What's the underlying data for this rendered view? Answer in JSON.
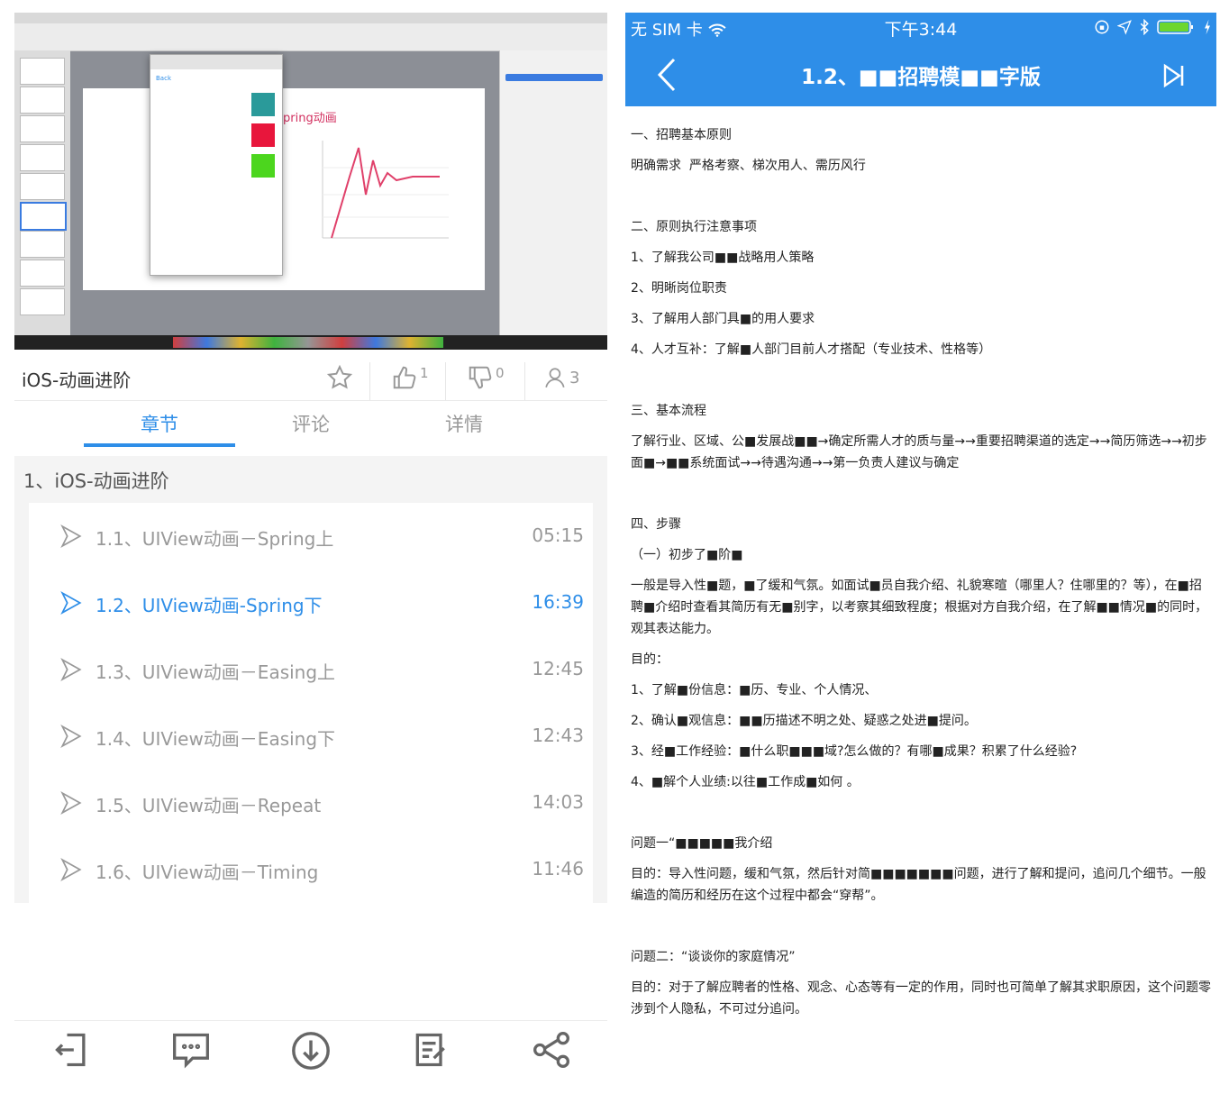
{
  "course": {
    "title": "iOS-动画进阶",
    "likes": "1",
    "dislikes": "0",
    "students": "3"
  },
  "video_preview": {
    "slide_title": "pring动画",
    "back_label": "Back"
  },
  "tabs": [
    {
      "label": "章节",
      "active": true
    },
    {
      "label": "评论",
      "active": false
    },
    {
      "label": "详情",
      "active": false
    }
  ],
  "section": {
    "title": "1、iOS-动画进阶"
  },
  "lessons": [
    {
      "label": "1.1、UIView动画－Spring上",
      "duration": "05:15",
      "active": false
    },
    {
      "label": "1.2、UIView动画-Spring下",
      "duration": "16:39",
      "active": true
    },
    {
      "label": "1.3、UIView动画－Easing上",
      "duration": "12:45",
      "active": false
    },
    {
      "label": "1.4、UIView动画－Easing下",
      "duration": "12:43",
      "active": false
    },
    {
      "label": "1.5、UIView动画－Repeat",
      "duration": "14:03",
      "active": false
    },
    {
      "label": "1.6、UIView动画－Timing",
      "duration": "11:46",
      "active": false
    }
  ],
  "bottom_toolbar": [
    "exit-icon",
    "message-icon",
    "download-icon",
    "note-icon",
    "share-icon"
  ],
  "phone": {
    "carrier": "无 SIM 卡",
    "time": "下午3:44",
    "nav_title": "1.2、■■招聘模■■字版"
  },
  "document": {
    "p1": "一、招聘基本原则",
    "p2": "明确需求  严格考察、梯次用人、需历风行",
    "p3": "二、原则执行注意事项",
    "p4": "1、了解我公司■■战略用人策略",
    "p5": "2、明晰岗位职责",
    "p6": "3、了解用人部门具■的用人要求",
    "p7": "4、人才互补：了解■人部门目前人才搭配（专业技术、性格等）",
    "p8": "三、基本流程",
    "p9": "了解行业、区域、公■发展战■■→确定所需人才的质与量→→重要招聘渠道的选定→→简历筛选→→初步面■→■■系统面试→→待遇沟通→→第一负责人建议与确定",
    "p10": "四、步骤",
    "p11": "（一）初步了■阶■",
    "p12": "一般是导入性■题，■了缓和气氛。如面试■员自我介绍、礼貌寒暄（哪里人？住哪里的？等），在■招聘■介绍时查看其简历有无■别字，以考察其细致程度；根据对方自我介绍，在了解■■情况■的同时，观其表达能力。",
    "p13": "目的：",
    "p14": "1、了解■份信息：■历、专业、个人情况、",
    "p15": "2、确认■观信息：■■历描述不明之处、疑惑之处进■提问。",
    "p16": "3、经■工作经验：■什么职■■■域?怎么做的？有哪■成果？积累了什么经验?",
    "p17": "4、■解个人业绩:以往■工作成■如何 。",
    "p18": "问题一“■■■■■我介绍",
    "p19": "目的：导入性问题，缓和气氛，然后针对简■■■■■■■问题，进行了解和提问，追问几个细节。一般编造的简历和经历在这个过程中都会“穿帮”。",
    "p20": "问题二：“谈谈你的家庭情况”",
    "p21": "目的：对于了解应聘者的性格、观念、心态等有一定的作用，同时也可简单了解其求职原因，这个问题零涉到个人隐私，不可过分追问。"
  },
  "colors": {
    "accent": "#2e8ee8",
    "text_muted": "#999999"
  }
}
